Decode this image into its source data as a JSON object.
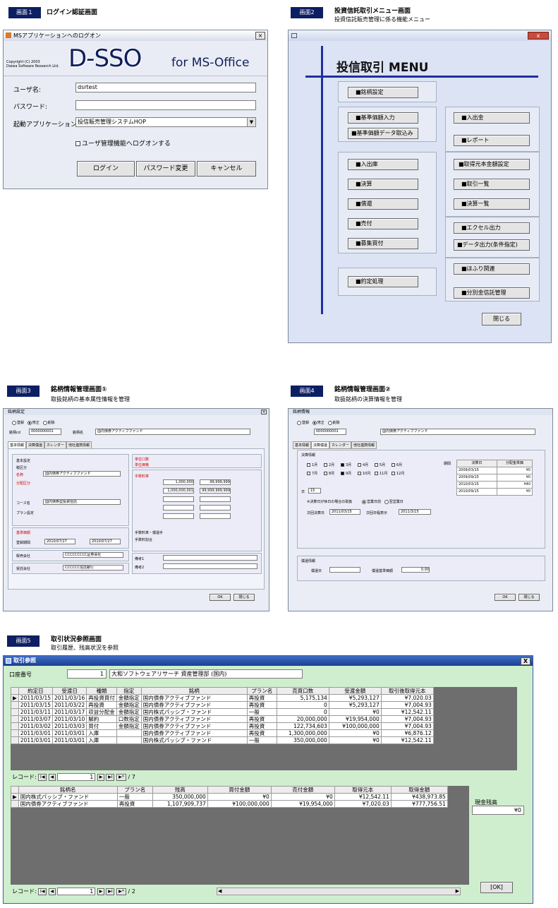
{
  "screen1": {
    "badge": "画面１",
    "title": "ログイン認証画面",
    "window_title": "MSアプリケーションへのログオン",
    "close": "×",
    "copyright": "Copyright (C) 2003\nDaiwa Software Research Ltd.",
    "logo": "D-SSO",
    "logo_suffix": "for MS-Office",
    "user_label": "ユーザ名:",
    "user_value": "dsrtest",
    "password_label": "パスワード:",
    "password_value": "",
    "app_label": "起動アプリケーション:",
    "app_value": "投信販売管理システムHOP",
    "checkbox_label": "ユーザ管理機能へログオンする",
    "login_button": "ログイン",
    "change_password_button": "パスワード変更",
    "cancel_button": "キャンセル"
  },
  "screen2": {
    "badge": "画面2",
    "title": "投資信託取引メニュー画面",
    "subtitle": "投資信託販売管理に係る機能メニュー",
    "menu_title": "投信取引 MENU",
    "close": "x",
    "buttons": [
      "■銘柄設定",
      "■基準価額入力",
      "■基準価額データ取込み",
      "■入出庫",
      "■決算",
      "■償還",
      "■売付",
      "■募集買付",
      "■約定処理",
      "■入出金",
      "■レポート",
      "■取得元本金額設定",
      "■取引一覧",
      "■決算一覧",
      "■エクセル出力",
      "■データ出力(条件指定)",
      "■ほふり関連",
      "■分別金信託管理"
    ],
    "close_button": "閉じる"
  },
  "screen3": {
    "badge": "画面3",
    "title": "銘柄情報管理画面①",
    "subtitle": "取扱銘柄の基本属性情報を管理",
    "window_title": "銘柄設定",
    "modes": [
      "登録",
      "修正",
      "削除"
    ],
    "code_label": "銘柄cd",
    "code_value": "0000000001",
    "name_label": "銘柄名",
    "name_value": "国内債券アクティブファンド",
    "tabs": [
      "基本情報",
      "決算償還",
      "カレンダー",
      "他社連携情報"
    ],
    "field_labels": [
      "基本設定",
      "税区分",
      "名称",
      "分配区分",
      "コース名",
      "プラン設定",
      "基準価額",
      "登録期間",
      "販売会社",
      "受託会社",
      "単位口数",
      "単位価格",
      "基準価額",
      "手数料率",
      "手数料率・償還手",
      "手数料割合",
      "備考1",
      "備考2"
    ],
    "course_value": "国内債券型投資信託",
    "fund_value": "国内債券アクティブファンド",
    "date_from": "2010/07/27",
    "date_to": "2010/07/27",
    "sales_company": "CCCCCCCCC証券会社",
    "trustee": "CCCCCC信託銀行",
    "amounts": [
      "1,000,000",
      "99,999,999",
      "1,000,000,001",
      "99,999,999,999"
    ],
    "ok_button": "OK",
    "close_button": "閉じる"
  },
  "screen4": {
    "badge": "画面4",
    "title": "銘柄情報管理画面②",
    "subtitle": "取扱銘柄の決算情報を管理",
    "window_title": "銘柄情報",
    "modes": [
      "登録",
      "修正",
      "削除"
    ],
    "code_value": "0000000001",
    "name_value": "国内債券アクティブファンド",
    "tabs": [
      "基本情報",
      "決算償還",
      "カレンダー",
      "他社連携情報"
    ],
    "settle_group": "決算情報",
    "months": [
      "1月",
      "2月",
      "3月",
      "4月",
      "5月",
      "6月",
      "7月",
      "8月",
      "9月",
      "10月",
      "11月",
      "12月"
    ],
    "day_label": "日",
    "day_value": "15",
    "holiday_label": "※決算日が休日の場合の取扱",
    "holiday_options": [
      "営業日前",
      "翌営業日"
    ],
    "next_date_label": "次回決算日",
    "next_date_value": "2011/03/15",
    "display_label": "次回日程表示",
    "display_value": "2011/3/15",
    "history_headers": [
      "決算日",
      "分配金単価"
    ],
    "history_rows": [
      [
        "2009/03/15",
        "¥0"
      ],
      [
        "2009/09/15",
        "¥0"
      ],
      [
        "2010/03/15",
        "¥40"
      ],
      [
        "2010/09/15",
        "¥0"
      ]
    ],
    "period_label": "期間",
    "redeem_group": "償還情報",
    "redeem_label": "償還日",
    "redeem_price_label": "償還基準価額",
    "redeem_price_value": "0.00",
    "ok_button": "OK",
    "close_button": "閉じる"
  },
  "screen5": {
    "badge": "画面5",
    "title": "取引状況参照画面",
    "subtitle": "取引履歴、残高状況を参照",
    "window_title": "取引参照",
    "close": "X",
    "account_label": "口座番号",
    "account_value": "1",
    "account_name": "大和ソフトウェアリサーチ 資産管理部 (国内)",
    "upper_headers": [
      "約定日",
      "受渡日",
      "種類",
      "指定",
      "銘柄",
      "プラン名",
      "売買口数",
      "受渡金額",
      "取引後取得元本"
    ],
    "upper_rows": [
      [
        "2011/03/15",
        "2011/03/16",
        "再投資買付",
        "金額指定",
        "国内債券アクティブファンド",
        "再投資",
        "5,175,134",
        "¥5,293,127",
        "¥7,020.03"
      ],
      [
        "2011/03/15",
        "2011/03/22",
        "再投資",
        "金額指定",
        "国内債券アクティブファンド",
        "再投資",
        "0",
        "¥5,293,127",
        "¥7,004.93"
      ],
      [
        "2011/03/11",
        "2011/03/17",
        "収益分配金",
        "金額指定",
        "国内株式パッシブ・ファンド",
        "一般",
        "0",
        "¥0",
        "¥12,542.11"
      ],
      [
        "2011/03/07",
        "2011/03/10",
        "解約",
        "口数指定",
        "国内債券アクティブファンド",
        "再投資",
        "20,000,000",
        "¥19,954,000",
        "¥7,004.93"
      ],
      [
        "2011/03/02",
        "2011/03/03",
        "買付",
        "金額指定",
        "国内債券アクティブファンド",
        "再投資",
        "122,734,603",
        "¥100,000,000",
        "¥7,004.93"
      ],
      [
        "2011/03/01",
        "2011/03/01",
        "入庫",
        "",
        "国内債券アクティブファンド",
        "再投資",
        "1,300,000,000",
        "¥0",
        "¥6,876.12"
      ],
      [
        "2011/03/01",
        "2011/03/01",
        "入庫",
        "",
        "国内株式パッシブ・ファンド",
        "一般",
        "350,000,000",
        "¥0",
        "¥12,542.11"
      ]
    ],
    "upper_record": "1",
    "upper_total": "/ 7",
    "lower_headers": [
      "銘柄名",
      "プラン名",
      "残高",
      "買付金額",
      "売付金額",
      "取得元本",
      "取得金額"
    ],
    "lower_rows": [
      [
        "国内株式パッシブ・ファンド",
        "一般",
        "350,000,000",
        "¥0",
        "¥0",
        "¥12,542.11",
        "¥438,973.85"
      ],
      [
        "国内債券アクティブファンド",
        "再投資",
        "1,107,909,737",
        "¥100,000,000",
        "¥19,954,000",
        "¥7,020.03",
        "¥777,756.51"
      ]
    ],
    "lower_record": "1",
    "lower_total": "/ 2",
    "record_label": "レコード:",
    "cash_label": "現金残高",
    "cash_value": "¥0",
    "ok_button": "OK"
  }
}
